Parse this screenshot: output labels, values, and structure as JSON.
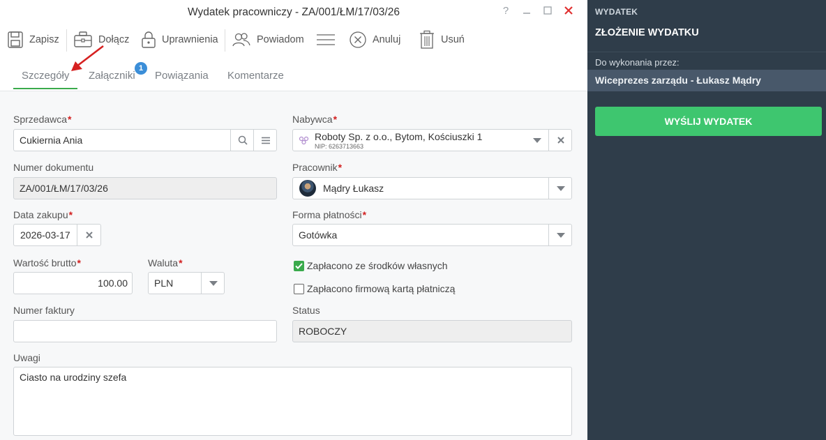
{
  "window": {
    "title": "Wydatek pracowniczy - ZA/001/ŁM/17/03/26",
    "help": "?"
  },
  "toolbar": {
    "save": "Zapisz",
    "attach": "Dołącz",
    "permissions": "Uprawnienia",
    "notify": "Powiadom",
    "cancel": "Anuluj",
    "delete": "Usuń"
  },
  "tabs": [
    {
      "label": "Szczegóły",
      "active": true
    },
    {
      "label": "Załączniki",
      "badge": "1"
    },
    {
      "label": "Powiązania"
    },
    {
      "label": "Komentarze"
    }
  ],
  "form": {
    "seller": {
      "label": "Sprzedawca",
      "value": "Cukiernia Ania"
    },
    "buyer": {
      "label": "Nabywca",
      "value": "Roboty Sp. z o.o., Bytom, Kościuszki 1",
      "nip": "NIP: 6263713663"
    },
    "document_number": {
      "label": "Numer dokumentu",
      "value": "ZA/001/ŁM/17/03/26"
    },
    "employee": {
      "label": "Pracownik",
      "value": "Mądry Łukasz"
    },
    "purchase_date": {
      "label": "Data zakupu",
      "value": "2026-03-17"
    },
    "payment_form": {
      "label": "Forma płatności",
      "value": "Gotówka"
    },
    "gross_value": {
      "label": "Wartość brutto",
      "value": "100.00"
    },
    "currency": {
      "label": "Waluta",
      "value": "PLN"
    },
    "paid_own_funds": {
      "label": "Zapłacono ze środków własnych",
      "checked": true
    },
    "paid_company_card": {
      "label": "Zapłacono firmową kartą płatniczą",
      "checked": false
    },
    "invoice_number": {
      "label": "Numer faktury",
      "value": ""
    },
    "status": {
      "label": "Status",
      "value": "ROBOCZY"
    },
    "notes": {
      "label": "Uwagi",
      "value": "Ciasto na urodziny szefa"
    },
    "required_mark": "*"
  },
  "side": {
    "kicker": "WYDATEK",
    "title": "ZŁOŻENIE WYDATKU",
    "assignee_label": "Do wykonania przez:",
    "assignee": "Wiceprezes zarządu - Łukasz Mądry",
    "action": "WYŚLIJ WYDATEK"
  },
  "colors": {
    "accent_green": "#3aaa4c",
    "sidebar_bg": "#2f3d4a",
    "send_button": "#3ec66f",
    "required": "#d21f1f",
    "badge": "#3b8ed8",
    "arrow": "#d62020"
  },
  "icons": [
    "save-icon",
    "briefcase-icon",
    "lock-icon",
    "people-icon",
    "menu-icon",
    "cancel-circle-icon",
    "trash-icon",
    "search-icon",
    "list-icon",
    "chevron-down-icon",
    "clear-icon",
    "company-icon",
    "check-icon",
    "red-arrow-annotation"
  ]
}
